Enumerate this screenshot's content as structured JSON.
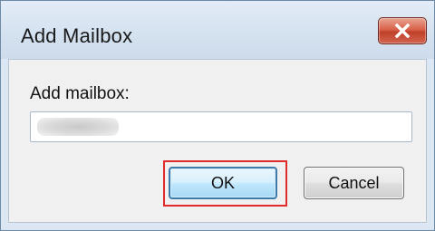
{
  "window": {
    "title": "Add Mailbox"
  },
  "icons": {
    "close": "close-icon"
  },
  "form": {
    "label": "Add mailbox:",
    "input_value": ""
  },
  "buttons": {
    "ok_label": "OK",
    "cancel_label": "Cancel"
  },
  "colors": {
    "highlight": "#e02b2b",
    "close_button": "#c7432d",
    "ok_border": "#3d7bad"
  }
}
